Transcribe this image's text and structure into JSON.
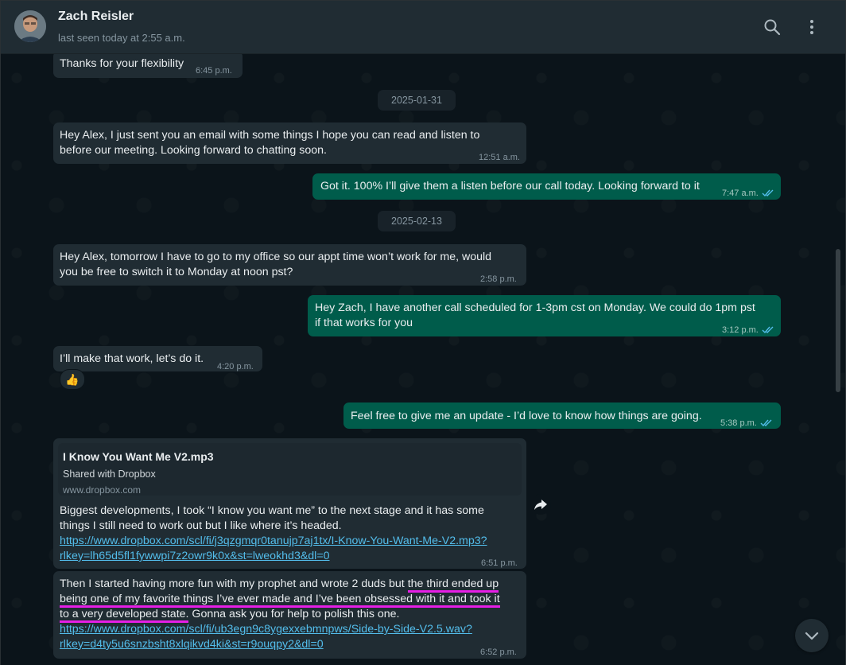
{
  "header": {
    "name": "Zach Reisler",
    "status": "last seen today at 2:55 a.m."
  },
  "messages": {
    "m1": {
      "text": "Thanks for your flexibility",
      "time": "6:45 p.m."
    },
    "date1": "2025-01-31",
    "m2": {
      "line1": "Hey Alex, I just sent you an email with some things I hope you can read and listen to",
      "line2": "before our meeting. Looking forward to chatting soon.",
      "time": "12:51 a.m."
    },
    "m3": {
      "text": "Got it. 100% I’ll give them a listen before our call today. Looking forward to it",
      "time": "7:47 a.m."
    },
    "date2": "2025-02-13",
    "m4": {
      "line1": "Hey Alex, tomorrow I have to go to my office so our appt time won’t work for me, would",
      "line2": "you be free to switch it to Monday at noon pst?",
      "time": "2:58 p.m."
    },
    "m5": {
      "line1": "Hey Zach, I have another call scheduled for 1-3pm cst on Monday. We could do 1pm pst",
      "line2": "if that works for you",
      "time": "3:12 p.m."
    },
    "m6": {
      "text": "I’ll make that work, let’s do it.",
      "time": "4:20 p.m.",
      "reaction": "👍"
    },
    "m7": {
      "text": "Feel free to give me an update - I’d love to know how things are going.",
      "time": "5:38 p.m."
    },
    "m8": {
      "preview_title": "I Know You Want Me V2.mp3",
      "preview_sub": "Shared with Dropbox",
      "preview_domain": "www.dropbox.com",
      "line1": "Biggest developments, I took “I know you want me” to the next stage and it has some",
      "line2": "things I still need to work out but I like where it’s headed.",
      "link1": "https://www.dropbox.com/scl/fi/j3qzgmqr0tanujp7aj1tx/I-Know-You-Want-Me-V2.mp3?",
      "link2": "rlkey=lh65d5fl1fywwpi7z2owr9k0x&st=lweokhd3&dl=0",
      "time": "6:51 p.m."
    },
    "m9": {
      "l1a": "Then I started having more fun with my prophet and wrote 2 duds but ",
      "l1b": "the third ended up",
      "l2": "being one of my favorite things I’ve ever made and I’ve been obsessed with it and took it",
      "l3a": "to a very developed state.",
      "l3b": " Gonna ask you for help to polish this one.",
      "link1": "https://www.dropbox.com/scl/fi/ub3egn9c8ygexxebmnpws/Side-by-Side-V2.5.wav?",
      "link2": "rlkey=d4ty5u6snzbsht8xlqikvd4ki&st=r9ouqpy2&dl=0",
      "time": "6:52 p.m."
    }
  },
  "colors": {
    "incoming": "#202c33",
    "outgoing": "#005c4b",
    "link": "#53bdeb",
    "highlight": "#e61ee6"
  },
  "icons": [
    "search-icon",
    "menu-dots-icon",
    "double-check-icon",
    "forward-icon",
    "chevron-down-icon"
  ]
}
